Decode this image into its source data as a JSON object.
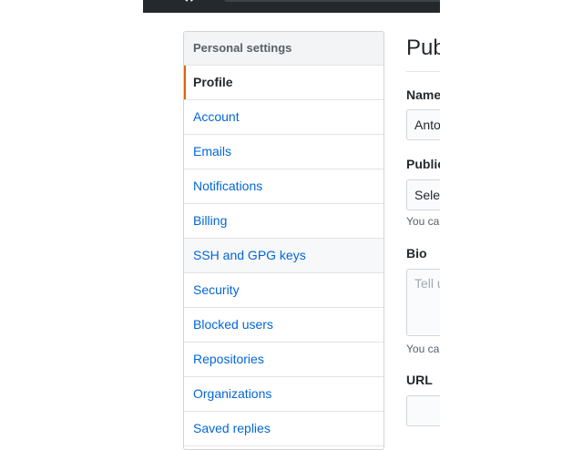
{
  "menu": {
    "heading": "Personal settings",
    "items": [
      {
        "label": "Profile",
        "state": "selected"
      },
      {
        "label": "Account",
        "state": ""
      },
      {
        "label": "Emails",
        "state": ""
      },
      {
        "label": "Notifications",
        "state": ""
      },
      {
        "label": "Billing",
        "state": ""
      },
      {
        "label": "SSH and GPG keys",
        "state": "hover"
      },
      {
        "label": "Security",
        "state": ""
      },
      {
        "label": "Blocked users",
        "state": ""
      },
      {
        "label": "Repositories",
        "state": ""
      },
      {
        "label": "Organizations",
        "state": ""
      },
      {
        "label": "Saved replies",
        "state": ""
      }
    ]
  },
  "main": {
    "title": "Pub",
    "name_label": "Name",
    "name_value": "Anto",
    "public_email_label": "Public",
    "public_email_select": "Sele",
    "public_email_note": "You ca",
    "bio_label": "Bio",
    "bio_placeholder": "Tell u",
    "bio_note": "You ca",
    "url_label": "URL",
    "url_value": ""
  },
  "colors": {
    "header_bg": "#24292e",
    "link": "#0366d6",
    "selected_accent": "#e36209"
  }
}
